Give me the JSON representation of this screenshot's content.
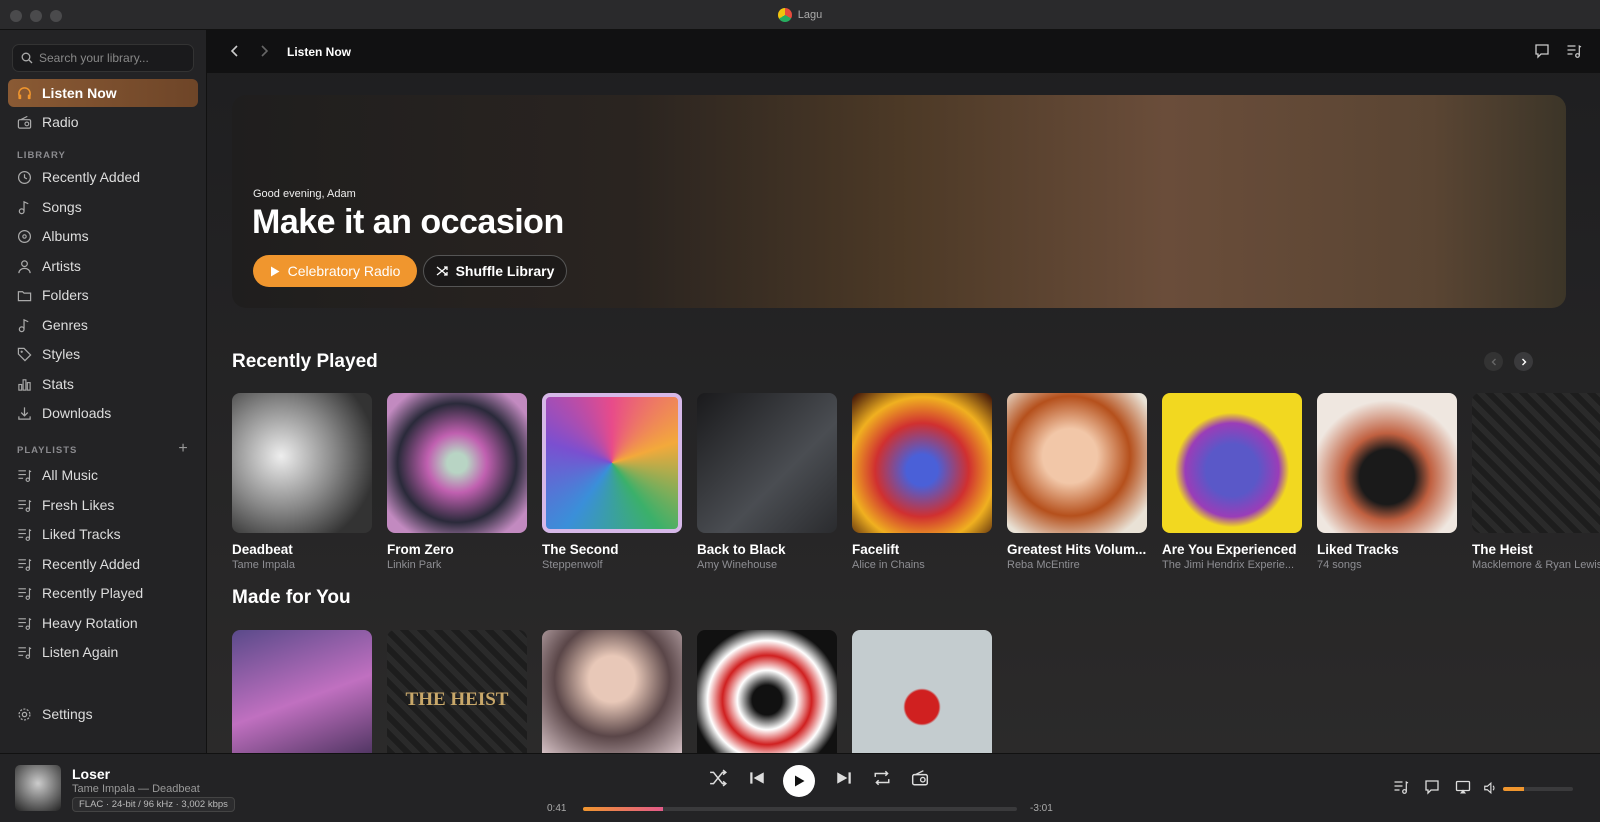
{
  "window": {
    "title": "Lagu"
  },
  "search": {
    "placeholder": "Search your library..."
  },
  "sidebar": {
    "top_items": [
      {
        "label": "Listen Now",
        "icon": "headphones-icon",
        "active": true
      },
      {
        "label": "Radio",
        "icon": "radio-icon"
      }
    ],
    "library_label": "LIBRARY",
    "library_items": [
      {
        "label": "Recently Added",
        "icon": "clock-icon"
      },
      {
        "label": "Songs",
        "icon": "music-note-icon"
      },
      {
        "label": "Albums",
        "icon": "disc-icon"
      },
      {
        "label": "Artists",
        "icon": "person-icon"
      },
      {
        "label": "Folders",
        "icon": "folder-icon"
      },
      {
        "label": "Genres",
        "icon": "music-note-icon"
      },
      {
        "label": "Styles",
        "icon": "tag-icon"
      },
      {
        "label": "Stats",
        "icon": "bar-chart-icon"
      },
      {
        "label": "Downloads",
        "icon": "download-icon"
      }
    ],
    "playlists_label": "PLAYLISTS",
    "add_playlist": "+",
    "playlist_items": [
      {
        "label": "All Music"
      },
      {
        "label": "Fresh Likes"
      },
      {
        "label": "Liked Tracks"
      },
      {
        "label": "Recently Added"
      },
      {
        "label": "Recently Played"
      },
      {
        "label": "Heavy Rotation"
      },
      {
        "label": "Listen Again"
      }
    ],
    "settings_label": "Settings"
  },
  "toolbar": {
    "breadcrumb": "Listen Now"
  },
  "hero": {
    "greeting": "Good evening, Adam",
    "headline": "Make it an occasion",
    "primary_label": "Celebratory Radio",
    "secondary_label": "Shuffle Library",
    "accent": "#f0962e"
  },
  "recently_played": {
    "title": "Recently Played",
    "items": [
      {
        "title": "Deadbeat",
        "subtitle": "Tame Impala"
      },
      {
        "title": "From Zero",
        "subtitle": "Linkin Park"
      },
      {
        "title": "The Second",
        "subtitle": "Steppenwolf"
      },
      {
        "title": "Back to Black",
        "subtitle": "Amy Winehouse"
      },
      {
        "title": "Facelift",
        "subtitle": "Alice in Chains"
      },
      {
        "title": "Greatest Hits Volum...",
        "subtitle": "Reba McEntire"
      },
      {
        "title": "Are You Experienced",
        "subtitle": "The Jimi Hendrix Experie..."
      },
      {
        "title": "Liked Tracks",
        "subtitle": "74 songs"
      },
      {
        "title": "The Heist",
        "subtitle": "Macklemore & Ryan Lewis"
      }
    ]
  },
  "made_for_you": {
    "title": "Made for You",
    "cover_texts": [
      "",
      "THE HEIST",
      "",
      "",
      ""
    ]
  },
  "player": {
    "title": "Loser",
    "artist_album": "Tame Impala — Deadbeat",
    "format": "FLAC · 24-bit / 96 kHz · 3,002 kbps",
    "elapsed": "0:41",
    "remaining": "-3:01",
    "progress": 0.185,
    "volume": 0.3
  }
}
